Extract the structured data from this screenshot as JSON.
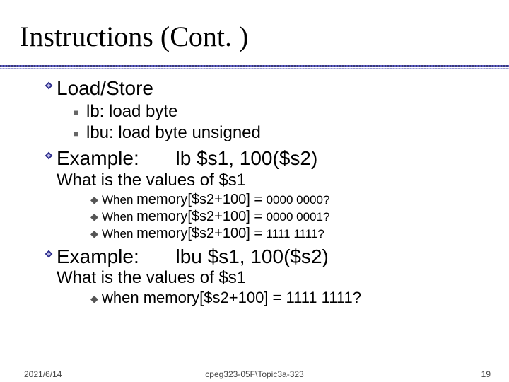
{
  "title": "Instructions (Cont. )",
  "section1": {
    "heading": "Load/Store",
    "items": [
      "lb: load byte",
      "lbu: load byte unsigned"
    ]
  },
  "example1": {
    "label": "Example:",
    "code": "lb $s1, 100($s2)",
    "question": "What is the values of $s1",
    "cases": [
      {
        "prefix": "When ",
        "mid": "memory[$s2+100] = ",
        "val": "0000 0000?"
      },
      {
        "prefix": "When ",
        "mid": "memory[$s2+100] = ",
        "val": "0000 0001?"
      },
      {
        "prefix": "When ",
        "mid": "memory[$s2+100] = ",
        "val": "1111 1111?"
      }
    ]
  },
  "example2": {
    "label": "Example:",
    "code": "lbu $s1, 100($s2)",
    "question": "What is the values of $s1",
    "cases": [
      {
        "prefix": "when ",
        "mid": "memory[$s2+100] = 1111 1111?"
      }
    ]
  },
  "footer": {
    "date": "2021/6/14",
    "mid": "cpeg323-05F\\Topic3a-323",
    "page": "19"
  }
}
